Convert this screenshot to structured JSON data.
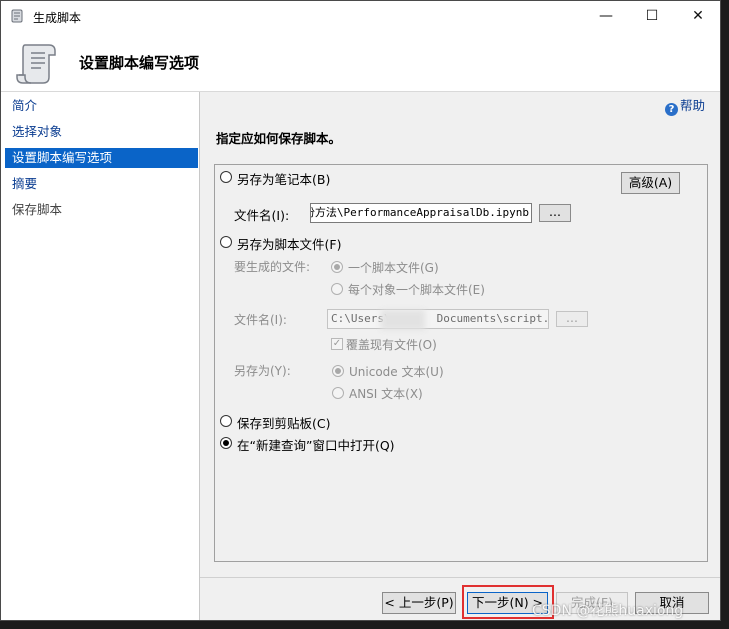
{
  "window": {
    "title": "生成脚本",
    "controls": {
      "minimize": "—",
      "maximize": "☐",
      "close": "✕"
    }
  },
  "header": {
    "title": "设置脚本编写选项",
    "icon": "scroll-icon"
  },
  "nav": {
    "items": [
      {
        "label": "简介"
      },
      {
        "label": "选择对象"
      },
      {
        "label": "设置脚本编写选项"
      },
      {
        "label": "摘要"
      },
      {
        "label": "保存脚本"
      }
    ]
  },
  "help": {
    "label": "帮助"
  },
  "main": {
    "prompt": "指定应如何保存脚本。",
    "advanced_button": "高级(A)",
    "notebook": {
      "radio_label": "另存为笔记本(B)",
      "file_label": "文件名(I):",
      "file_value": "备份方法\\PerformanceAppraisalDb.ipynb",
      "browse": "..."
    },
    "script_file": {
      "radio_label": "另存为脚本文件(F)",
      "files_to_generate_label": "要生成的文件:",
      "option_single": "一个脚本文件(G)",
      "option_per_object": "每个对象一个脚本文件(E)",
      "file_label": "文件名(I):",
      "file_value_prefix": "C:\\Users\\",
      "file_value_suffix": "Documents\\script.sql",
      "browse": "...",
      "overwrite_label": "覆盖现有文件(O)",
      "save_as_label": "另存为(Y):",
      "encoding_unicode": "Unicode 文本(U)",
      "encoding_ansi": "ANSI 文本(X)"
    },
    "clipboard": {
      "radio_label": "保存到剪贴板(C)"
    },
    "new_query": {
      "radio_label": "在“新建查询”窗口中打开(Q)"
    }
  },
  "footer": {
    "prev": "< 上一步(P)",
    "next": "下一步(N) >",
    "finish": "完成(F)",
    "cancel": "取消"
  },
  "watermark": "CSDN @花熊huaxiong",
  "colors": {
    "selection": "#0a64c8",
    "link": "#0b3d91",
    "highlight": "#e03030"
  }
}
